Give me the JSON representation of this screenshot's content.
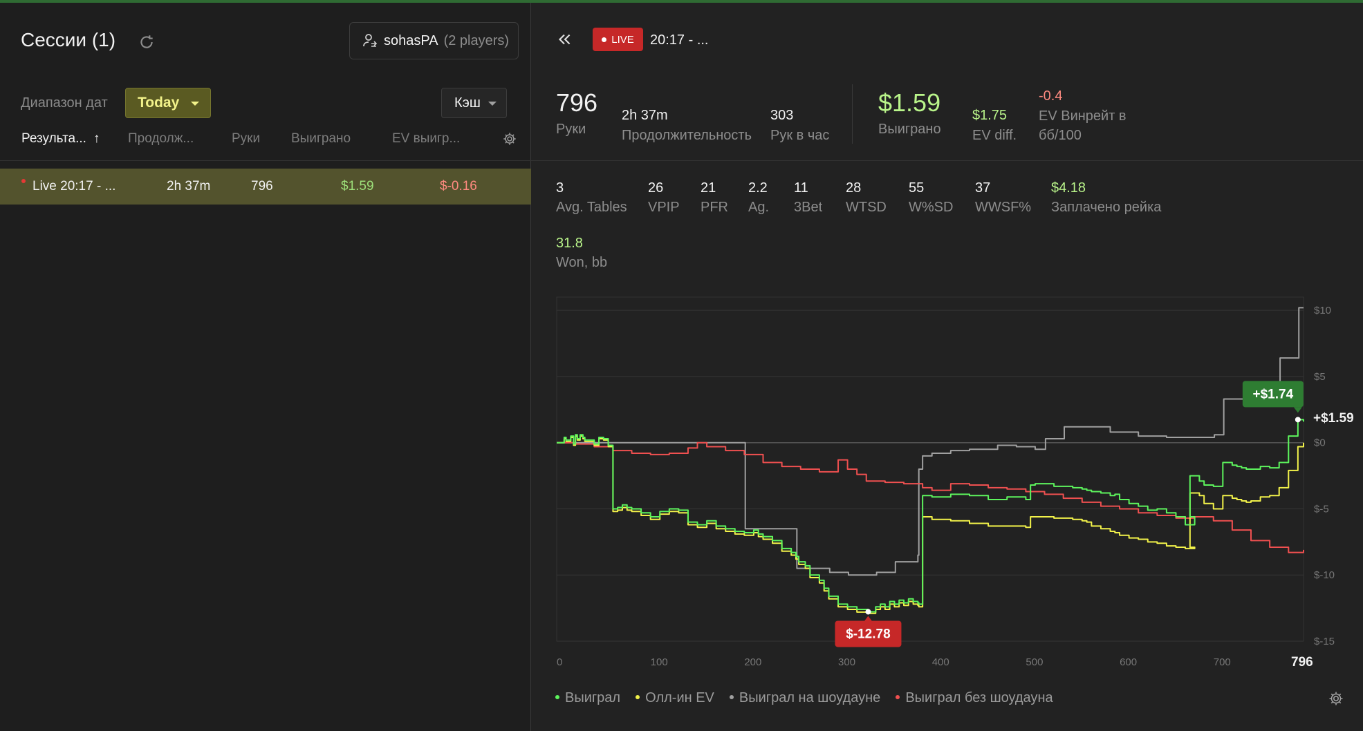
{
  "colors": {
    "accent_green": "#b9f48a",
    "live_red": "#c62828",
    "selected_row": "#53532d",
    "date_select": "#5a5a22"
  },
  "sidebar": {
    "title": "Сессии (1)",
    "refresh_icon": "refresh-icon",
    "player": {
      "name": "sohasPA",
      "count": "(2 players)",
      "icon": "user-switch-icon"
    },
    "date_range_label": "Диапазон дат",
    "date_range_value": "Today",
    "game_type_value": "Кэш",
    "columns": [
      "Результа...",
      "Продолж...",
      "Руки",
      "Выиграно",
      "EV выигр..."
    ],
    "sort_indicator": "↑",
    "sessions": [
      {
        "name": "Live 20:17 - ...",
        "duration": "2h 37m",
        "hands": "796",
        "won": "$1.59",
        "ev_won": "$-0.16"
      }
    ]
  },
  "session": {
    "live_label": "LIVE",
    "time": "20:17 - ...",
    "summary": {
      "hands": {
        "value": "796",
        "label": "Руки"
      },
      "duration": {
        "value": "2h 37m",
        "label": "Продолжительность"
      },
      "hands_per_hour": {
        "value": "303",
        "label": "Рук в час"
      },
      "won": {
        "value": "$1.59",
        "label": "Выиграно"
      },
      "ev_diff": {
        "value": "$1.75",
        "label": "EV diff."
      },
      "ev_winrate": {
        "value": "-0.4",
        "label_line1": "EV Винрейт в",
        "label_line2": "бб/100"
      }
    },
    "stats": [
      {
        "value": "3",
        "label": "Avg. Tables"
      },
      {
        "value": "26",
        "label": "VPIP"
      },
      {
        "value": "21",
        "label": "PFR"
      },
      {
        "value": "2.2",
        "label": "Ag."
      },
      {
        "value": "11",
        "label": "3Bet"
      },
      {
        "value": "28",
        "label": "WTSD"
      },
      {
        "value": "55",
        "label": "W%SD"
      },
      {
        "value": "37",
        "label": "WWSF%"
      },
      {
        "value": "$4.18",
        "label": "Заплачено рейка"
      }
    ],
    "won_bb": {
      "value": "31.8",
      "label": "Won, bb"
    }
  },
  "chart_data": {
    "type": "line",
    "xlim": [
      0,
      796
    ],
    "ylim": [
      -15,
      11
    ],
    "x_ticks": [
      0,
      100,
      200,
      300,
      400,
      500,
      600,
      700
    ],
    "x_last_label": "796",
    "y_ticks": [
      10,
      5,
      0,
      -5,
      -10,
      -15
    ],
    "y_tick_labels": [
      "$10",
      "$5",
      "$0",
      "$-5",
      "$-10",
      "$-15"
    ],
    "end_label": "+$1.59",
    "max_label": "+$1.74",
    "max_point": [
      790,
      1.74
    ],
    "min_label": "$-12.78",
    "min_point": [
      332,
      -12.78
    ],
    "series": [
      {
        "name": "Выиграл",
        "color": "#5df55d",
        "x": [
          0,
          8,
          10,
          15,
          18,
          20,
          22,
          25,
          28,
          30,
          40,
          45,
          50,
          55,
          60,
          65,
          70,
          75,
          80,
          90,
          100,
          110,
          120,
          130,
          140,
          150,
          160,
          170,
          180,
          190,
          200,
          210,
          215,
          220,
          230,
          240,
          250,
          255,
          258,
          265,
          270,
          280,
          285,
          290,
          300,
          310,
          320,
          332,
          340,
          345,
          350,
          355,
          360,
          365,
          370,
          375,
          380,
          385,
          386,
          390,
          400,
          420,
          440,
          460,
          480,
          500,
          505,
          510,
          530,
          550,
          560,
          565,
          570,
          580,
          590,
          595,
          600,
          610,
          620,
          630,
          640,
          650,
          660,
          670,
          680,
          675,
          685,
          690,
          700,
          710,
          720,
          725,
          730,
          735,
          740,
          750,
          760,
          770,
          780,
          790,
          796
        ],
        "values": [
          0,
          0.4,
          0.2,
          0.5,
          -0.1,
          0.6,
          0.3,
          0.6,
          0.4,
          0.2,
          -0.1,
          0.4,
          0.3,
          -0.2,
          -5.0,
          -4.9,
          -4.7,
          -4.9,
          -5.0,
          -5.3,
          -5.6,
          -5.2,
          -5.0,
          -5.1,
          -6.0,
          -6.2,
          -5.9,
          -6.3,
          -6.5,
          -6.7,
          -6.8,
          -6.6,
          -6.9,
          -7.1,
          -7.4,
          -8.0,
          -8.3,
          -8.6,
          -9.0,
          -9.3,
          -10.0,
          -10.4,
          -11.0,
          -11.6,
          -12.2,
          -12.4,
          -12.6,
          -12.78,
          -12.4,
          -12.2,
          -12.4,
          -12.0,
          -12.2,
          -11.9,
          -12.1,
          -11.8,
          -12.0,
          -12.1,
          -12.2,
          -4.0,
          -4.1,
          -3.9,
          -4.0,
          -4.3,
          -4.1,
          -4.3,
          -3.2,
          -3.1,
          -3.3,
          -3.4,
          -3.5,
          -3.6,
          -3.7,
          -3.8,
          -4.0,
          -3.9,
          -4.3,
          -4.6,
          -4.8,
          -5.1,
          -5.0,
          -5.3,
          -5.6,
          -6.2,
          -5.6,
          -2.5,
          -2.9,
          -3.2,
          -3.3,
          -1.5,
          -1.7,
          -1.8,
          -1.9,
          -2.0,
          -2.0,
          -1.8,
          -1.9,
          -1.5,
          0.5,
          1.74,
          1.59
        ]
      },
      {
        "name": "Олл-ин EV",
        "color": "#f2f24a",
        "x": [
          0,
          8,
          10,
          15,
          18,
          20,
          22,
          25,
          28,
          30,
          40,
          45,
          50,
          55,
          60,
          65,
          70,
          75,
          80,
          90,
          100,
          110,
          120,
          130,
          140,
          150,
          160,
          170,
          180,
          190,
          200,
          210,
          215,
          220,
          230,
          240,
          250,
          255,
          258,
          265,
          270,
          280,
          285,
          290,
          300,
          310,
          320,
          332,
          340,
          345,
          350,
          355,
          360,
          365,
          370,
          375,
          380,
          385,
          386,
          390,
          400,
          420,
          440,
          460,
          480,
          500,
          505,
          510,
          530,
          550,
          560,
          565,
          570,
          580,
          590,
          595,
          600,
          610,
          620,
          630,
          640,
          650,
          660,
          670,
          680,
          675,
          685,
          690,
          700,
          710,
          720,
          725,
          730,
          735,
          740,
          750,
          760,
          770,
          780,
          790,
          796
        ],
        "values": [
          0,
          0.3,
          0.1,
          0.4,
          -0.2,
          0.5,
          0.2,
          0.5,
          0.3,
          0.1,
          -0.2,
          0.3,
          0.2,
          -0.3,
          -5.2,
          -5.1,
          -4.9,
          -5.1,
          -5.2,
          -5.5,
          -5.8,
          -5.4,
          -5.2,
          -5.3,
          -6.2,
          -6.4,
          -6.1,
          -6.5,
          -6.7,
          -6.9,
          -7.0,
          -6.8,
          -7.1,
          -7.3,
          -7.6,
          -8.2,
          -8.5,
          -8.8,
          -9.2,
          -9.5,
          -10.2,
          -10.6,
          -11.2,
          -11.8,
          -12.4,
          -12.6,
          -12.8,
          -12.9,
          -12.6,
          -12.4,
          -12.6,
          -12.2,
          -12.4,
          -12.1,
          -12.3,
          -12.0,
          -12.2,
          -12.3,
          -12.4,
          -5.6,
          -5.8,
          -5.9,
          -6.1,
          -6.3,
          -6.3,
          -6.4,
          -5.6,
          -5.6,
          -5.7,
          -5.8,
          -5.9,
          -6.0,
          -6.3,
          -6.5,
          -6.7,
          -6.8,
          -7.0,
          -7.2,
          -7.3,
          -7.5,
          -7.6,
          -7.8,
          -7.9,
          -8.0,
          -7.9,
          -3.8,
          -4.0,
          -4.6,
          -5.0,
          -4.0,
          -4.2,
          -4.3,
          -4.4,
          -4.5,
          -4.4,
          -4.1,
          -4.0,
          -3.4,
          -2.1,
          -0.3,
          0.0
        ]
      },
      {
        "name": "Выиграл на шоудауне",
        "color": "#a0a0a0",
        "x": [
          0,
          15,
          55,
          200,
          201,
          230,
          231,
          255,
          256,
          290,
          291,
          310,
          311,
          340,
          341,
          360,
          361,
          380,
          385,
          386,
          390,
          400,
          420,
          440,
          470,
          490,
          510,
          520,
          521,
          540,
          541,
          580,
          590,
          600,
          620,
          640,
          650,
          700,
          701,
          710,
          711,
          740,
          741,
          770,
          771,
          790,
          791,
          796
        ],
        "values": [
          0,
          0,
          0,
          0,
          -6.5,
          -6.5,
          -6.5,
          -6.5,
          -9.5,
          -9.5,
          -9.8,
          -9.8,
          -10.0,
          -10.0,
          -9.8,
          -9.8,
          -9.0,
          -9.0,
          -8.5,
          -2.0,
          -1.0,
          -0.8,
          -0.6,
          -0.5,
          -0.2,
          -0.3,
          -0.5,
          -0.5,
          0.3,
          0.3,
          1.2,
          1.2,
          0.8,
          0.8,
          0.5,
          0.5,
          0.4,
          0.4,
          0.6,
          0.6,
          3.3,
          3.3,
          3.3,
          3.3,
          6.4,
          6.4,
          10.2,
          10.2
        ]
      },
      {
        "name": "Выиграл без шоудауна",
        "color": "#f05050",
        "x": [
          0,
          20,
          40,
          60,
          80,
          100,
          120,
          140,
          150,
          160,
          180,
          200,
          220,
          240,
          260,
          280,
          300,
          310,
          320,
          330,
          350,
          370,
          390,
          400,
          420,
          440,
          460,
          480,
          500,
          520,
          540,
          560,
          580,
          600,
          620,
          640,
          660,
          680,
          700,
          720,
          740,
          760,
          780,
          796
        ],
        "values": [
          0,
          -0.1,
          -0.3,
          -0.6,
          -0.8,
          -0.9,
          -0.8,
          -0.4,
          0.0,
          -0.3,
          -0.6,
          -0.9,
          -1.5,
          -1.8,
          -2.0,
          -2.2,
          -1.3,
          -2.0,
          -2.4,
          -2.9,
          -3.0,
          -3.1,
          -3.4,
          -3.6,
          -3.1,
          -3.2,
          -3.4,
          -3.5,
          -3.7,
          -3.9,
          -4.2,
          -4.5,
          -4.8,
          -5.0,
          -5.3,
          -5.5,
          -5.7,
          -5.6,
          -5.9,
          -6.6,
          -7.4,
          -7.9,
          -8.3,
          -8.1
        ]
      }
    ]
  }
}
